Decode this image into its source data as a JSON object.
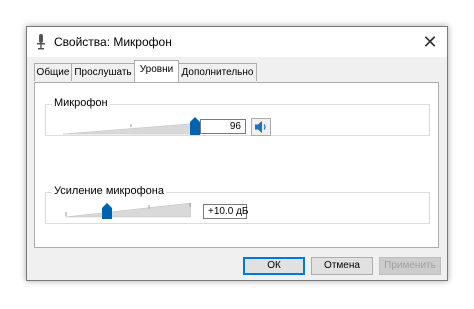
{
  "window": {
    "title": "Свойства: Микрофон",
    "close_glyph": "✕"
  },
  "tabs": [
    {
      "label": "Общие",
      "active": false
    },
    {
      "label": "Прослушать",
      "active": false
    },
    {
      "label": "Уровни",
      "active": true
    },
    {
      "label": "Дополнительно",
      "active": false
    }
  ],
  "microphone": {
    "label": "Микрофон",
    "value": "96",
    "level_fraction": 0.96,
    "mute_icon": "speaker-icon"
  },
  "boost": {
    "label": "Усиление микрофона",
    "value": "+10.0 дБ",
    "level_fraction": 0.33
  },
  "buttons": {
    "ok": "ОК",
    "cancel": "Отмена",
    "apply": "Применить"
  },
  "colors": {
    "accent": "#0078d7",
    "thumb": "#0063b1"
  }
}
